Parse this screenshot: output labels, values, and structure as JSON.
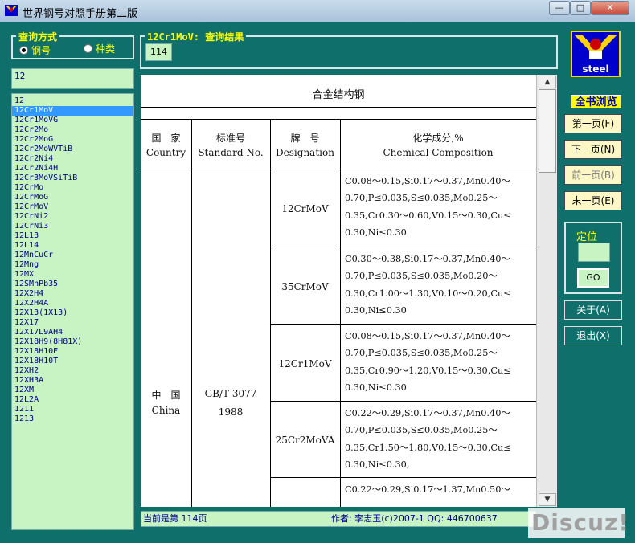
{
  "window": {
    "title": "世界钢号对照手册第二版",
    "min": "—",
    "max": "□",
    "close": "✕"
  },
  "query": {
    "group_title": "查询方式",
    "option_steel": "钢号",
    "option_type": "种类",
    "search_value": "12"
  },
  "steel_list": [
    "12",
    "12Cr1MoV",
    "12Cr1MoVG",
    "12Cr2Mo",
    "12Cr2MoG",
    "12Cr2MoWVTiB",
    "12Cr2Ni4",
    "12Cr2Ni4H",
    "12Cr3MoVSiTiB",
    "12CrMo",
    "12CrMoG",
    "12CrMoV",
    "12CrNi2",
    "12CrNi3",
    "12L13",
    "12L14",
    "12MnCuCr",
    "12Mng",
    "12MX",
    "12SMnPb35",
    "12X2H4",
    "12X2H4A",
    "12X13(1X13)",
    "12X17",
    "12X17L9AH4",
    "12X18H9(8H81X)",
    "12X18H10E",
    "12X18H10T",
    "12XH2",
    "12XH3A",
    "12XM",
    "12L2A",
    "1211",
    "1213"
  ],
  "selected_index": 1,
  "results": {
    "title": "12Cr1MoV: 查询结果",
    "page": "114"
  },
  "doc": {
    "heading": "合金结构钢",
    "col_country_cn": "国　家",
    "col_country_en": "Country",
    "col_std_cn": "标准号",
    "col_std_en": "Standard No.",
    "col_grade_cn": "牌　号",
    "col_grade_en": "Designation",
    "col_chem_cn": "化学成分,%",
    "col_chem_en": "Chemical Composition",
    "country_cn": "中　国",
    "country_en": "China",
    "std_line1": "GB/T 3077",
    "std_line2": "1988",
    "rows": [
      {
        "grade": "12CrMoV",
        "chem": [
          "C0.08～0.15,Si0.17～0.37,Mn0.40～",
          "0.70,P≤0.035,S≤0.035,Mo0.25～",
          "0.35,Cr0.30～0.60,V0.15～0.30,Cu≤",
          "0.30,Ni≤0.30"
        ]
      },
      {
        "grade": "35CrMoV",
        "chem": [
          "C0.30～0.38,Si0.17～0.37,Mn0.40～",
          "0.70,P≤0.035,S≤0.035,Mo0.20～",
          "0.30,Cr1.00～1.30,V0.10～0.20,Cu≤",
          "0.30,Ni≤0.30"
        ]
      },
      {
        "grade": "12Cr1MoV",
        "chem": [
          "C0.08～0.15,Si0.17～0.37,Mn0.40～",
          "0.70,P≤0.035,S≤0.035,Mo0.25～",
          "0.35,Cr0.90～1.20,V0.15～0.30,Cu≤",
          "0.30,Ni≤0.30"
        ]
      },
      {
        "grade": "25Cr2MoVA",
        "chem": [
          "C0.22～0.29,Si0.17～0.37,Mn0.40～",
          "0.70,P≤0.035,S≤0.035,Mo0.25～",
          "0.35,Cr1.50～1.80,V0.15～0.30,Cu≤",
          "0.30,Ni≤0.30,"
        ]
      },
      {
        "grade": "",
        "chem": [
          "C0.22～0.29,Si0.17～1.37,Mn0.50～"
        ]
      }
    ]
  },
  "status": {
    "left": "当前是第 114页",
    "right": "作者: 李志玉(c)2007-1   QQ: 446700637"
  },
  "watermark": "Discuz!",
  "logo_text": "steel",
  "side": {
    "book_title": "全书浏览",
    "first": "第一页(F)",
    "next": "下一页(N)",
    "prev": "前一页(B)",
    "last": "末一页(E)",
    "locate_label": "定位",
    "go": "GO",
    "about": "关于(A)",
    "exit": "退出(X)"
  }
}
